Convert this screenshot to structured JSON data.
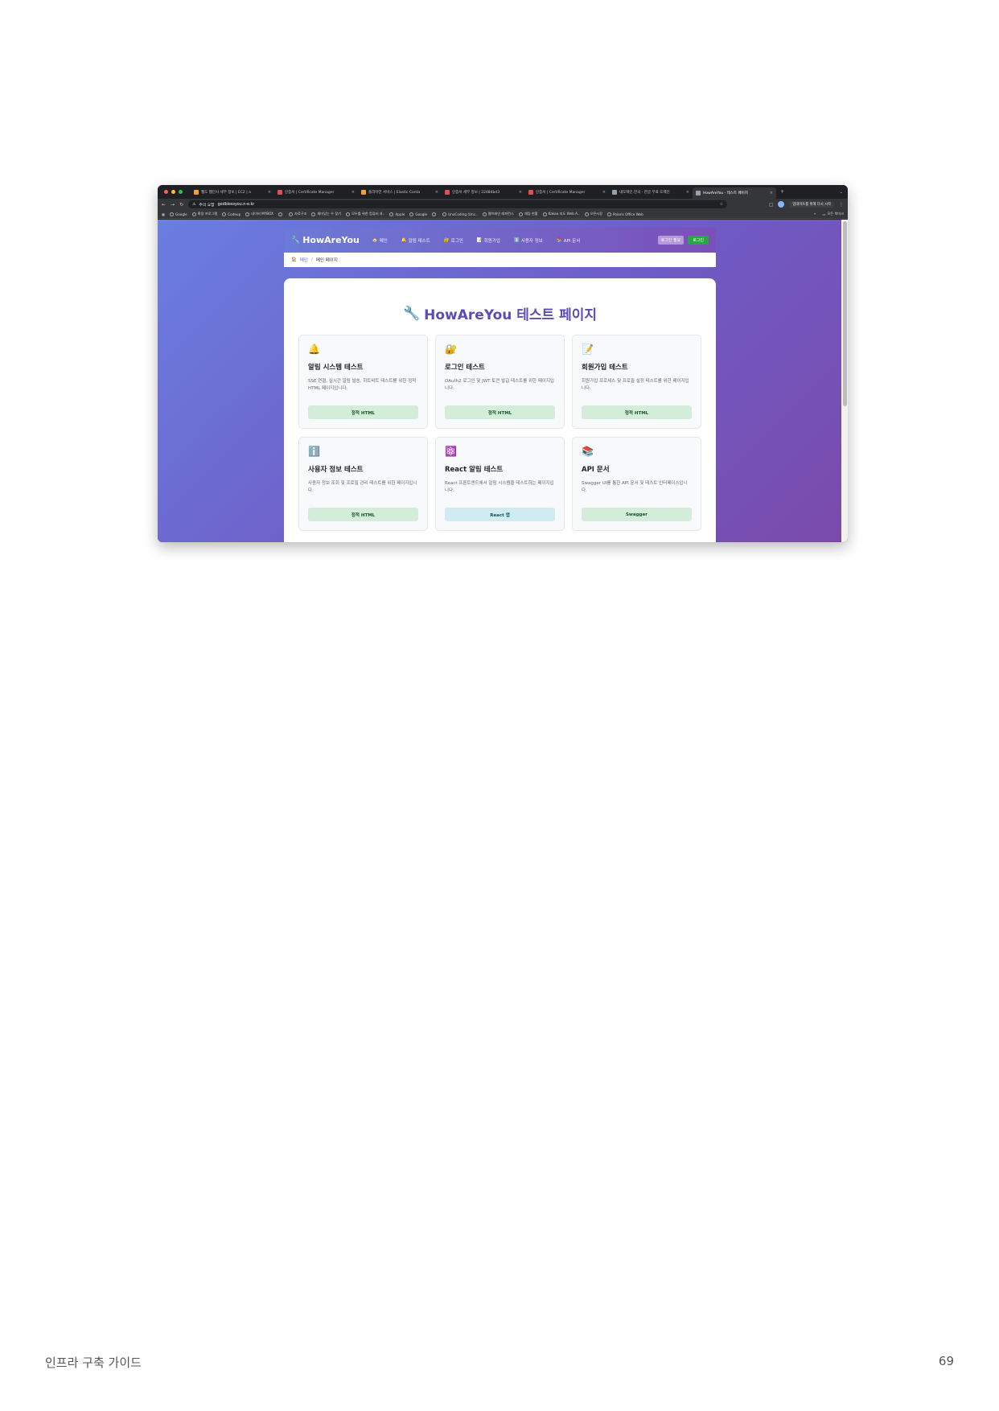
{
  "browser": {
    "tabs": [
      {
        "title": "웹도 웹인사 세부 정보 | EC2 | a",
        "color": "#f0a030"
      },
      {
        "title": "인증서 | Certificate Manager",
        "color": "#e05050"
      },
      {
        "title": "플리이언 서비스 | Elastic Conta",
        "color": "#f0a030"
      },
      {
        "title": "인증서 세부 정보 | 22484bd3",
        "color": "#e05050"
      },
      {
        "title": "인증서 | Certificate Manager",
        "color": "#e05050"
      },
      {
        "title": "내도메인.한국 - 한글 무료 도메인",
        "color": "#9aa0a6"
      },
      {
        "title": "HowAreYou - 테스트 페이지",
        "color": "#9aa0a6",
        "active": true
      }
    ],
    "address": {
      "warning": "주의 요함",
      "url": "godblessyou.n-e.kr"
    },
    "update_label": "업데이트를 위해 다시 시작",
    "bookmarks": [
      "Google",
      "확장 프로그램",
      "Codeup",
      "네이버 MYBOX",
      "",
      "자료구조",
      "재미있는 수 찾기",
      "모두를 위한 컴퓨터 과..",
      "Apple",
      "Google",
      "",
      "UnoCoding (Unc..",
      "웹브레인 레퍼런스",
      "채팅 현황",
      "Kakao 지도 Web A..",
      "오픈시장",
      "Polaris Office Web"
    ],
    "bookmarks_overflow": "»",
    "bookmarks_folder": "모든 북마크"
  },
  "site": {
    "brand": "HowAreYou",
    "nav": [
      {
        "icon": "🏠",
        "label": "메인"
      },
      {
        "icon": "🔔",
        "label": "알림 테스트"
      },
      {
        "icon": "🔐",
        "label": "로그인"
      },
      {
        "icon": "📝",
        "label": "회원가입"
      },
      {
        "icon": "ℹ️",
        "label": "사용자 정보"
      },
      {
        "icon": "📚",
        "label": "API 문서"
      }
    ],
    "login_needed": "로그인 필요",
    "login_button": "로그인",
    "breadcrumb": {
      "home": "메인",
      "separator": "/",
      "current": "메인 페이지"
    },
    "page_title": "HowAreYou 테스트 페이지",
    "cards": [
      {
        "icon": "🔔",
        "title": "알림 시스템 테스트",
        "desc": "SSE 연결, 실시간 알림 발송, 하트비트 테스트를 위한 정적 HTML 페이지입니다.",
        "button": "정적 HTML",
        "style": "green"
      },
      {
        "icon": "🔐",
        "title": "로그인 테스트",
        "desc": "OAuth2 로그인 및 JWT 토큰 발급 테스트를 위한 페이지입니다.",
        "button": "정적 HTML",
        "style": "green"
      },
      {
        "icon": "📝",
        "title": "회원가입 테스트",
        "desc": "회원가입 프로세스 및 프로필 설정 테스트를 위한 페이지입니다.",
        "button": "정적 HTML",
        "style": "green"
      },
      {
        "icon": "ℹ️",
        "title": "사용자 정보 테스트",
        "desc": "사용자 정보 조회 및 프로필 관리 테스트를 위한 페이지입니다.",
        "button": "정적 HTML",
        "style": "green"
      },
      {
        "icon": "⚛️",
        "title": "React 알림 테스트",
        "desc": "React 프론트엔드에서 알림 시스템을 테스트하는 페이지입니다.",
        "button": "React 앱",
        "style": "blue"
      },
      {
        "icon": "📚",
        "title": "API 문서",
        "desc": "Swagger UI를 통한 API 문서 및 테스트 인터페이스입니다.",
        "button": "Swagger",
        "style": "green"
      }
    ]
  },
  "footer": {
    "title": "인프라 구축 가이드",
    "page_number": "69"
  }
}
